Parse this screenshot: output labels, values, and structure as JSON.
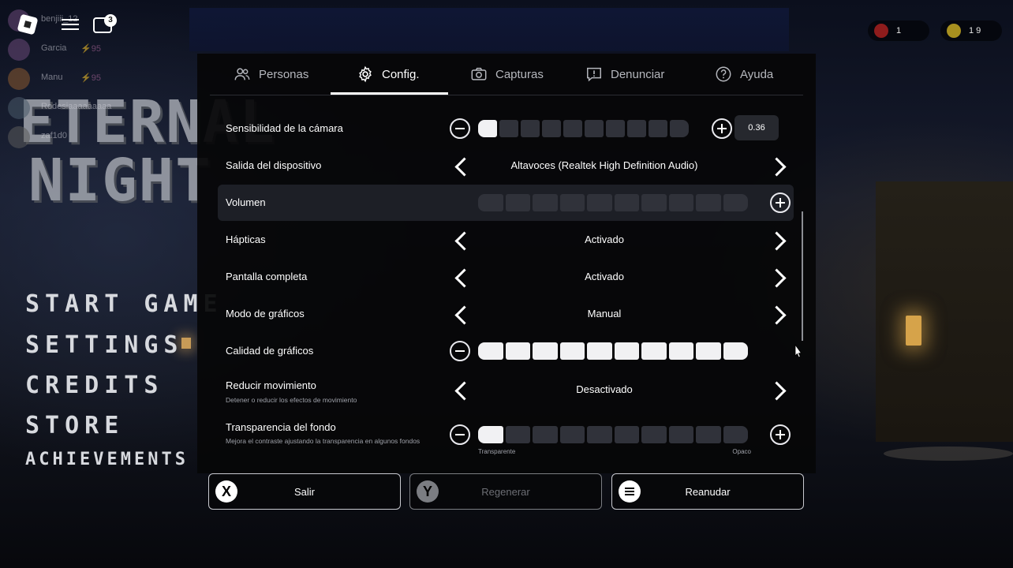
{
  "background": {
    "game_title_line1": "ETERNAL",
    "game_title_line2": "NIGHT",
    "menu": {
      "start": "START GAME",
      "settings": "SETTINGS",
      "credits": "CREDITS",
      "store": "STORE",
      "achievements": "ACHIEVEMENTS"
    },
    "players": [
      {
        "name": "benjiii_12",
        "stat": ""
      },
      {
        "name": "Garcia",
        "stat": "⚡95"
      },
      {
        "name": "Manu",
        "stat": "⚡95"
      },
      {
        "name": "Rodesiaaaaaaaaa",
        "stat": ""
      },
      {
        "name": "zaf1d0",
        "stat": ""
      }
    ],
    "chat_badge": "3",
    "stats": {
      "red": "1",
      "gold": "1 9"
    }
  },
  "tabs": [
    {
      "label": "Personas",
      "icon": "people-icon"
    },
    {
      "label": "Config.",
      "icon": "gear-icon"
    },
    {
      "label": "Capturas",
      "icon": "camera-icon"
    },
    {
      "label": "Denunciar",
      "icon": "report-icon"
    },
    {
      "label": "Ayuda",
      "icon": "help-icon"
    }
  ],
  "settings": {
    "camera": {
      "label": "Sensibilidad de la cámara",
      "value": "0.36",
      "level": 0.1
    },
    "output": {
      "label": "Salida del dispositivo",
      "value": "Altavoces (Realtek High Definition Audio)"
    },
    "volume": {
      "label": "Volumen",
      "level": 0
    },
    "haptics": {
      "label": "Hápticas",
      "value": "Activado"
    },
    "fullscreen": {
      "label": "Pantalla completa",
      "value": "Activado"
    },
    "graphics_mode": {
      "label": "Modo de gráficos",
      "value": "Manual"
    },
    "graphics_quality": {
      "label": "Calidad de gráficos",
      "level": 1.0
    },
    "reduce_motion": {
      "label": "Reducir movimiento",
      "sub": "Detener o reducir los efectos de movimiento",
      "value": "Desactivado"
    },
    "bg_transparency": {
      "label": "Transparencia del fondo",
      "sub": "Mejora el contraste ajustando la transparencia en algunos fondos",
      "level": 0.1,
      "left_label": "Transparente",
      "right_label": "Opaco"
    }
  },
  "buttons": {
    "exit": {
      "label": "Salir",
      "key": "X"
    },
    "regen": {
      "label": "Regenerar",
      "key": "Y"
    },
    "resume": {
      "label": "Reanudar"
    }
  },
  "colors": {
    "panel_bg": "#060608",
    "segment_on": "#f1f1f3",
    "segment_off": "#30323a",
    "highlight_row": "#1d1f26"
  }
}
